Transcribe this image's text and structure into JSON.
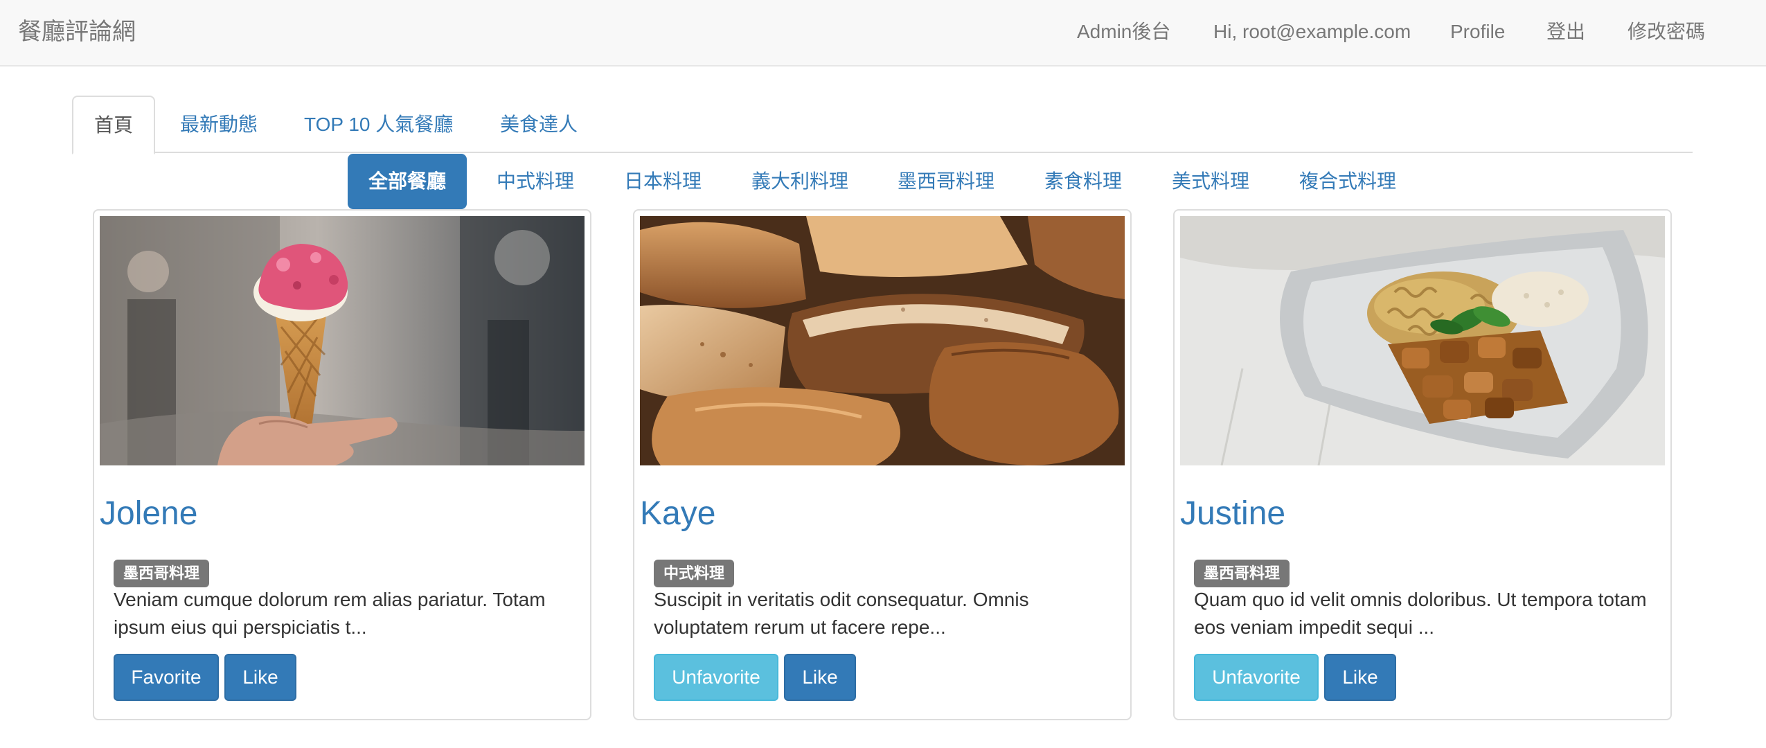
{
  "navbar": {
    "brand": "餐廳評論網",
    "links": [
      "Admin後台",
      "Hi, root@example.com",
      "Profile",
      "登出",
      "修改密碼"
    ]
  },
  "tabs": [
    "首頁",
    "最新動態",
    "TOP 10 人氣餐廳",
    "美食達人"
  ],
  "active_tab": "首頁",
  "categories": [
    "全部餐廳",
    "中式料理",
    "日本料理",
    "義大利料理",
    "墨西哥料理",
    "素食料理",
    "美式料理",
    "複合式料理"
  ],
  "active_category": "全部餐廳",
  "restaurants": [
    {
      "name": "Jolene",
      "category": "墨西哥料理",
      "description": "Veniam cumque dolorum rem alias pariatur. Totam ipsum eius qui perspiciatis t...",
      "favorite_label": "Favorite",
      "like_label": "Like",
      "image": "ice-cream-cone-photo"
    },
    {
      "name": "Kaye",
      "category": "中式料理",
      "description": "Suscipit in veritatis odit consequatur. Omnis voluptatem rerum ut facere repe...",
      "favorite_label": "Unfavorite",
      "like_label": "Like",
      "image": "bread-loaves-photo"
    },
    {
      "name": "Justine",
      "category": "墨西哥料理",
      "description": "Quam quo id velit omnis doloribus. Ut tempora totam eos veniam impedit sequi ...",
      "favorite_label": "Unfavorite",
      "like_label": "Like",
      "image": "pasta-chicken-plate-photo"
    }
  ],
  "colors": {
    "primary": "#337ab7",
    "info": "#5bc0de",
    "badge": "#777777",
    "navbar_bg": "#f8f8f8"
  }
}
